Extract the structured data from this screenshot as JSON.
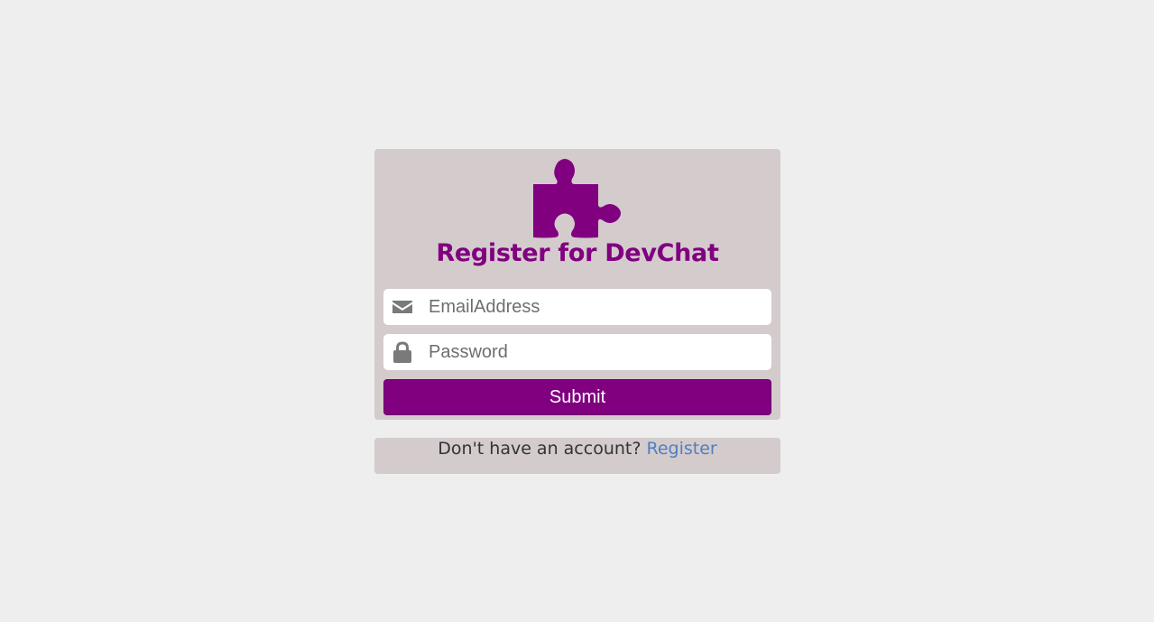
{
  "form": {
    "title": "Register for DevChat",
    "logo_icon": "puzzle-piece-icon",
    "email": {
      "icon": "envelope-icon",
      "value": "",
      "placeholder": "EmailAddress"
    },
    "password": {
      "icon": "lock-icon",
      "value": "",
      "placeholder": "Password"
    },
    "submit_label": "Submit"
  },
  "footer": {
    "prompt": "Don't have an account?",
    "link_label": "Register"
  },
  "colors": {
    "page_background": "#eeeeee",
    "card_background": "#d4cbcc",
    "accent": "#800080",
    "icon_gray": "#7a7a7a",
    "link": "#4f7fc0"
  }
}
